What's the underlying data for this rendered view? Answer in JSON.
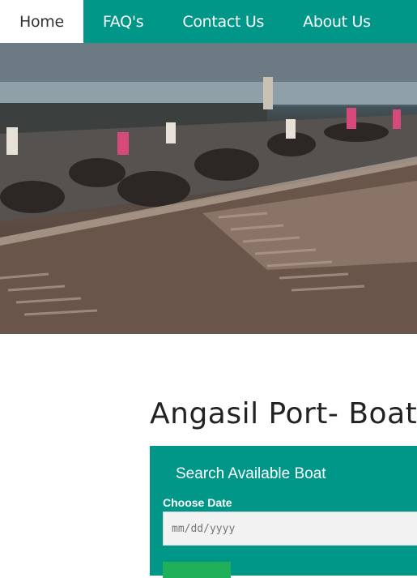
{
  "nav": {
    "items": [
      {
        "label": "Home",
        "active": true
      },
      {
        "label": "FAQ's",
        "active": false
      },
      {
        "label": "Contact Us",
        "active": false
      },
      {
        "label": "About Us",
        "active": false
      }
    ]
  },
  "hero": {
    "image": "port-boardwalk-photo"
  },
  "main": {
    "title": "Angasil Port- Boat"
  },
  "search": {
    "heading": "Search Available Boat",
    "date_label": "Choose Date",
    "date_placeholder": "mm/dd/yyyy"
  },
  "colors": {
    "primary": "#009688",
    "nav_active_bg": "#ffffff",
    "button": "#20b05a"
  }
}
